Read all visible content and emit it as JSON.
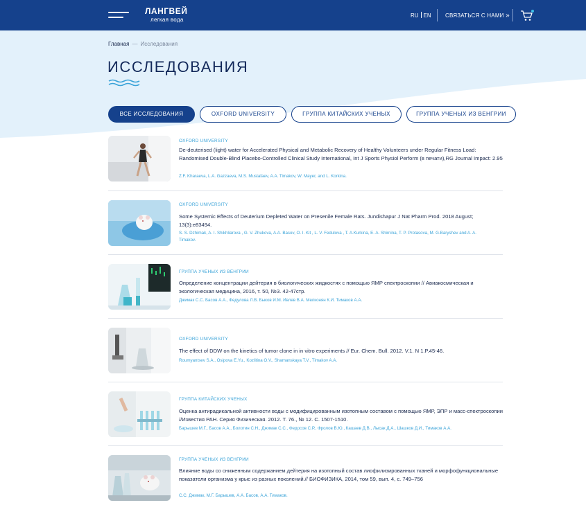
{
  "header": {
    "logo_name": "ЛАНГВЕЙ",
    "logo_sub": "легкая вода",
    "lang_ru": "RU",
    "lang_en": "EN",
    "contact_label": "СВЯЗАТЬСЯ С НАМИ",
    "contact_arrow": "»"
  },
  "breadcrumb": {
    "home": "Главная",
    "separator": "—",
    "current": "Исследования"
  },
  "page_title": "ИССЛЕДОВАНИЯ",
  "filters": [
    {
      "label": "ВСЕ ИССЛЕДОВАНИЯ",
      "active": true
    },
    {
      "label": "OXFORD UNIVERSITY",
      "active": false
    },
    {
      "label": "ГРУППА КИТАЙСКИХ УЧЕНЫХ",
      "active": false
    },
    {
      "label": "ГРУППА УЧЕНЫХ ИЗ ВЕНГРИИ",
      "active": false
    }
  ],
  "studies": [
    {
      "tag": "OXFORD UNIVERSITY",
      "title": "De-deuterised (light) water for Accelerated Physical and Metabolic Recovery of Healthy Volunteers under Regular Fitness Load: Randomised Double-Blind Placebo-Controlled Clinical Study International, Int J Sports Physiol Perform (в печати),RG Journal Impact: 2.95",
      "authors": "Z.F. Kharaeva, L.A. Gazzaeva, M.S. Mustafaev, A.A. Timakov, W. Mayer, and L. Korkina."
    },
    {
      "tag": "OXFORD UNIVERSITY",
      "title": "Some Systemic Effects of Deuterium Depleted Water on Presenile Female Rats. Jundishapur J Nat Pharm Prod. 2018 August; 13(3):e83494.",
      "authors": "S. S. Dzhimak, A. I. Shikhliarova , G. V. Zhukova, A.A. Basov, O. I. Kit , L. V. Fedulova , T. A.Kurkina, E. A. Shirnina, T. P. Protasova, M. G.Baryshev and A. A. Timakov."
    },
    {
      "tag": "ГРУППА УЧЕНЫХ ИЗ ВЕНГРИИ",
      "title": "Определение концентрации дейтерия в биологических жидкостях с помощью ЯМР спектроскопии // Авиакосмическая и экологическая медицина, 2016, т. 50, №3. 42-47стр.",
      "authors": "Джимак С.С. Басов А.А., Федулова Л.В. Быков И.М. Ивлев В.А. Мелконян К.И. Тимаков А.А."
    },
    {
      "tag": "OXFORD UNIVERSITY",
      "title": "The effect of DDW on the kinetics of tumor clone in in vitro experiments // Eur. Chem. Bull. 2012. V.1. N 1.P.45-46.",
      "authors": "Roumyantsev S.A., Osipova E.Yu., Kozlitina O.V., Shamanskaya T.V., Timakov A.A."
    },
    {
      "tag": "ГРУППА КИТАЙСКИХ УЧЕНЫХ",
      "title": "Оценка антирадикальной активности воды с модифицированным изотопным составом с помощью ЯМР, ЭПР и масс-спектроскопии //Известия РАН. Серия Физическая. 2012. Т. 76., № 12. С. 1507-1510.",
      "authors": "Барышев М.Г., Басов А.А., Болотин С.Н., Джимак С.С., Федосов С.Р., Фролов В.Ю., Кашаев Д.В., Лысак Д.А., Шашков Д.И., Тимаков А.А."
    },
    {
      "tag": "ГРУППА УЧЕНЫХ ИЗ ВЕНГРИИ",
      "title": "Влияние воды со сниженным содержанием дейтерия на изотопный состав лиофилизированных тканей и морфофункциональные показатели организма у крыс из разных поколений.// БИОФИЗИКА, 2014, том 59, вып. 4, с. 749–756",
      "authors": "С.С. Джимак, М.Г. Барышев, А.А. Басов, А.А. Тимаков."
    }
  ],
  "colors": {
    "header_bg": "#15418c",
    "accent_blue": "#3aa3d8",
    "hero_bg": "#e3f1fb",
    "text_dark": "#1b2a4e"
  }
}
